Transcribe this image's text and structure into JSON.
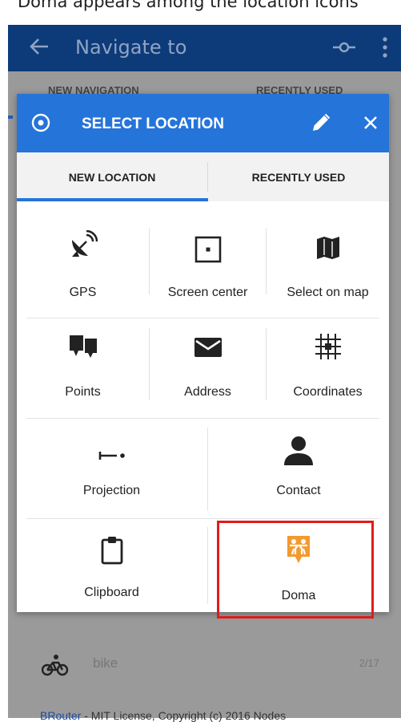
{
  "caption": {
    "text": "Doma appears among the location icons"
  },
  "app_bar": {
    "title": "Navigate to"
  },
  "background": {
    "tabs": [
      "NEW NAVIGATION",
      "RECENTLY USED"
    ],
    "route": {
      "label": "bike",
      "count": "2/17"
    },
    "footer_link": "BRouter",
    "footer_text": " - MIT License, Copyright (c) 2016 Nodes"
  },
  "dialog": {
    "title": "SELECT LOCATION",
    "tabs": {
      "new": "NEW LOCATION",
      "recent": "RECENTLY USED"
    },
    "grid": {
      "gps": "GPS",
      "screen_center": "Screen center",
      "select_on_map": "Select on map",
      "points": "Points",
      "address": "Address",
      "coordinates": "Coordinates",
      "projection": "Projection",
      "contact": "Contact",
      "clipboard": "Clipboard",
      "doma": "Doma"
    }
  },
  "colors": {
    "accent": "#2574d9",
    "app_bar": "#0d3b7a",
    "highlight": "#e11b1b",
    "doma_icon": "#f29a2e"
  }
}
